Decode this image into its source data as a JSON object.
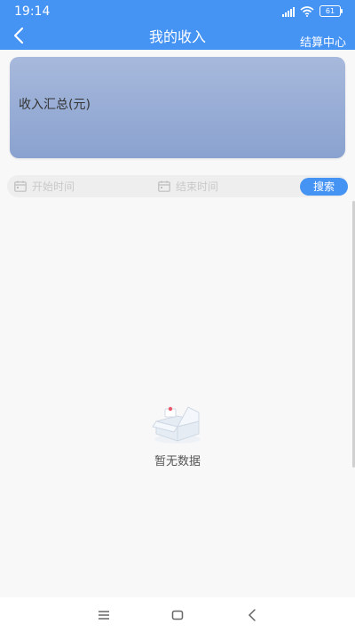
{
  "status_bar": {
    "time": "19:14",
    "battery": "61"
  },
  "nav": {
    "title": "我的收入",
    "action_label": "结算中心"
  },
  "summary": {
    "label": "收入汇总(元)"
  },
  "filter": {
    "start_placeholder": "开始时间",
    "end_placeholder": "结束时间",
    "search_label": "搜索"
  },
  "empty_state": {
    "text": "暂无数据"
  },
  "colors": {
    "primary": "#4593f3",
    "card_gradient_top": "#a7b9dc",
    "card_gradient_bottom": "#8aa2cf",
    "background": "#f8f8f8"
  }
}
